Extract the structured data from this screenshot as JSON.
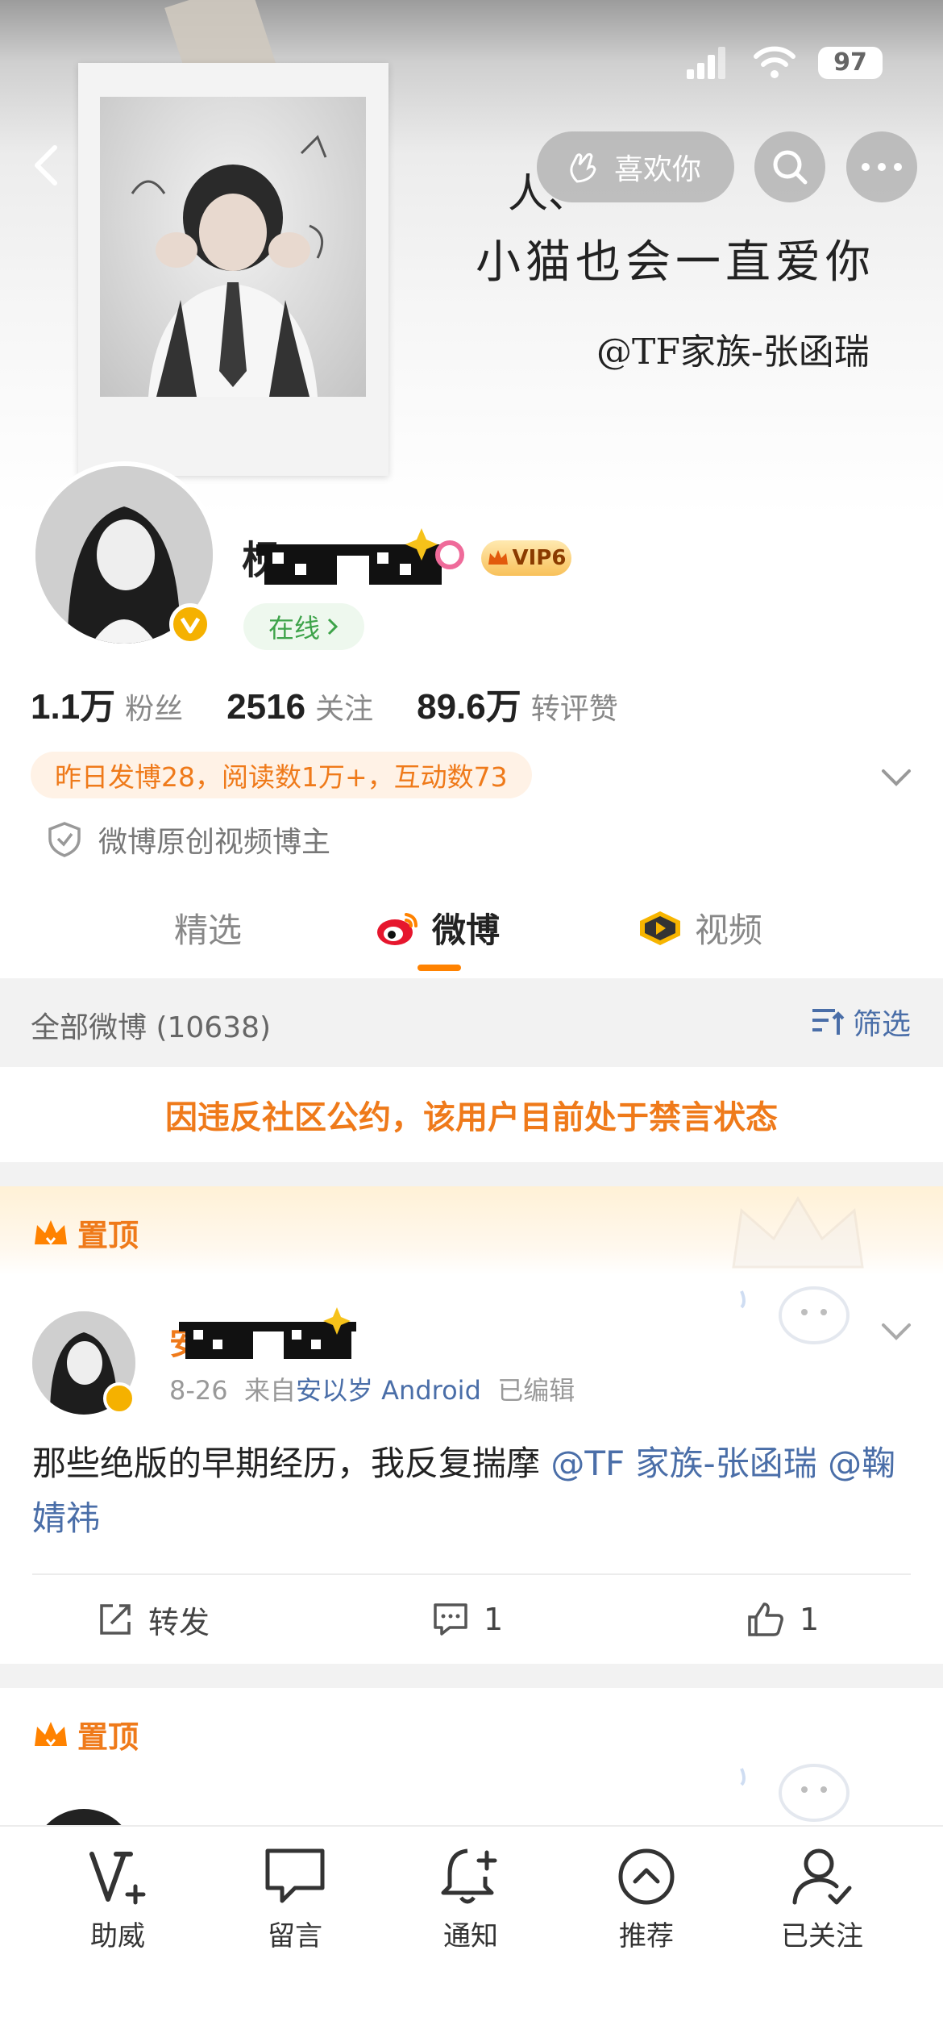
{
  "status_bar": {
    "battery": "97"
  },
  "cover": {
    "note_line1": "人、",
    "note_line2": "小猫也会一直爱你",
    "note_line3": "@TF家族-张函瑞"
  },
  "nav": {
    "like_label": "喜欢你"
  },
  "profile": {
    "name_prefix": "枧",
    "vip_label": "VIP6",
    "online_label": "在线",
    "stats": [
      {
        "value": "1.1万",
        "label": "粉丝"
      },
      {
        "value": "2516",
        "label": "关注"
      },
      {
        "value": "89.6万",
        "label": "转评赞"
      }
    ],
    "summary": "昨日发博28，阅读数1万+，互动数73",
    "creator_label": "微博原创视频博主"
  },
  "tabs": [
    {
      "label": "精选"
    },
    {
      "label": "微博"
    },
    {
      "label": "视频"
    }
  ],
  "filter": {
    "title": "全部微博 (10638)",
    "button": "筛选"
  },
  "ban_notice": "因违反社区公约，该用户目前处于禁言状态",
  "post": {
    "pin_label": "置顶",
    "author_initial": "安",
    "date": "8-26",
    "source_prefix": "来自",
    "source": "安以岁 Android",
    "edited": "已编辑",
    "text": "那些绝版的早期经历，我反复揣摩",
    "mention1": "@TF 家族-张函瑞",
    "mention2": "@鞠婧祎",
    "repost_label": "转发",
    "comment_count": "1",
    "like_count": "1"
  },
  "post2": {
    "pin_label": "置顶"
  },
  "bottom_bar": [
    {
      "label": "助威",
      "icon": "v-plus-icon"
    },
    {
      "label": "留言",
      "icon": "message-icon"
    },
    {
      "label": "通知",
      "icon": "bell-plus-icon"
    },
    {
      "label": "推荐",
      "icon": "chevron-up-circle-icon"
    },
    {
      "label": "已关注",
      "icon": "user-check-icon"
    }
  ],
  "colors": {
    "accent": "#ff8200",
    "link": "#4a6ea8",
    "online": "#3ea34a",
    "verify": "#f5b100"
  }
}
